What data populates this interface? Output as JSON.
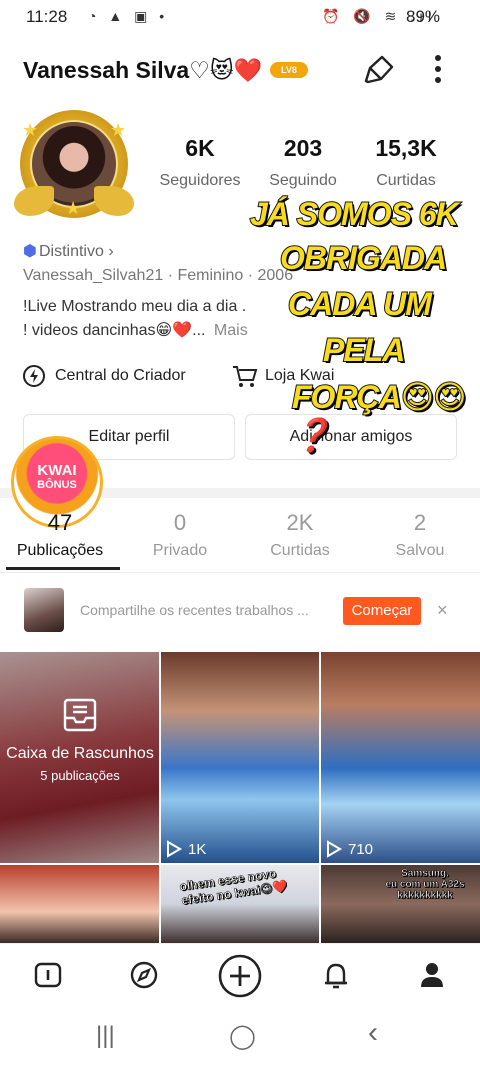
{
  "status_bar": {
    "time": "11:28",
    "left_icons": "◔ ▲ ▣ •",
    "right_icons": "⏰ 🔇 ≋ .ıl",
    "battery": "89%"
  },
  "header": {
    "name": "Vanessah Silva♡😻❤️",
    "level": "LV8"
  },
  "stats": [
    {
      "value": "6K",
      "label": "Seguidores"
    },
    {
      "value": "203",
      "label": "Seguindo"
    },
    {
      "value": "15,3K",
      "label": "Curtidas"
    }
  ],
  "bio": {
    "badge": "Distintivo ›",
    "user_line": "Vanessah_Silvah21 · Feminino · 2006",
    "line1": "!Live Mostrando meu dia a dia .",
    "line2": "! videos dancinhas😁❤️...",
    "more": "Mais"
  },
  "actions": {
    "creator": "Central do Criador",
    "shop": "Loja Kwai",
    "edit": "Editar perfil",
    "add_friends": "Adicionar amigos"
  },
  "sticker": {
    "line1": "JÁ SOMOS 6K",
    "line2": "OBRIGADA",
    "line3": "CADA UM",
    "line4": "PELA",
    "line5": "FORÇA😍😍❓"
  },
  "bonus": {
    "title": "KWAI",
    "subtitle": "BÔNUS"
  },
  "tabs": [
    {
      "value": "47",
      "label": "Publicações"
    },
    {
      "value": "0",
      "label": "Privado"
    },
    {
      "value": "2K",
      "label": "Curtidas"
    },
    {
      "value": "2",
      "label": "Salvou"
    }
  ],
  "share_banner": {
    "text": "Compartilhe os recentes trabalhos ...",
    "button": "Começar",
    "close": "×"
  },
  "grid": {
    "drafts_title": "Caixa de Rascunhos",
    "drafts_count": "5 publicações",
    "tile2_plays": "1K",
    "tile3_plays": "710",
    "tile5_caption": "olhem esse novo efeito no kwai😉❤️",
    "tile6_caption1": "Samsung.",
    "tile6_caption2": "eu com um A32s",
    "tile6_caption3": "kkkkkkkkkk"
  },
  "system_nav": {
    "recent": "|||",
    "home": "◯",
    "back": "‹"
  },
  "colors": {
    "accent": "#fe5a1f",
    "sticker_yellow": "#f8dc1c",
    "badge_blue": "#4e6ee8"
  }
}
